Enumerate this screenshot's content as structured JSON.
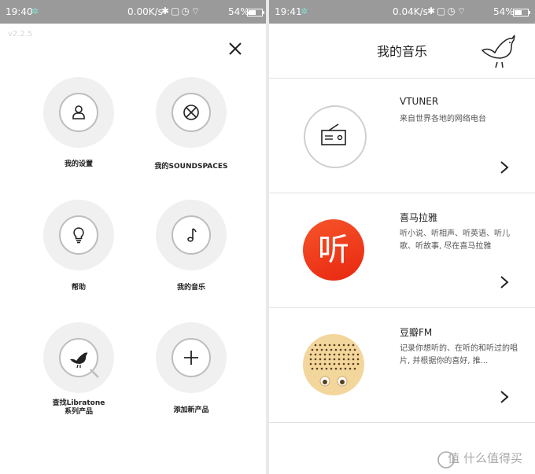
{
  "left": {
    "status": {
      "time": "19:40",
      "speed": "0.00K/s",
      "battery": "54%"
    },
    "version": "v2.2.5",
    "menu": [
      {
        "label": "我的设置"
      },
      {
        "label": "我的SOUNDSPACES"
      },
      {
        "label": "帮助"
      },
      {
        "label": "我的音乐"
      },
      {
        "label_line1": "查找Libratone",
        "label_line2": "系列产品"
      },
      {
        "label": "添加新产品"
      }
    ]
  },
  "right": {
    "status": {
      "time": "19:41",
      "speed": "0.04K/s",
      "battery": "54%"
    },
    "title": "我的音乐",
    "items": [
      {
        "name": "VTUNER",
        "desc": "来自世界各地的网络电台"
      },
      {
        "name": "喜马拉雅",
        "desc": "听小说、听相声、听英语、听儿歌、听故事, 尽在喜马拉雅",
        "logo_text": "听"
      },
      {
        "name": "豆瓣FM",
        "desc": "记录你想听的、在听的和听过的唱片, 并根据你的喜好, 推..."
      }
    ]
  },
  "watermark": "值 什么值得买",
  "colors": {
    "statusbar": "#9a9a9a",
    "ximalaya": "#f4441c",
    "douban": "#f3d69c"
  }
}
